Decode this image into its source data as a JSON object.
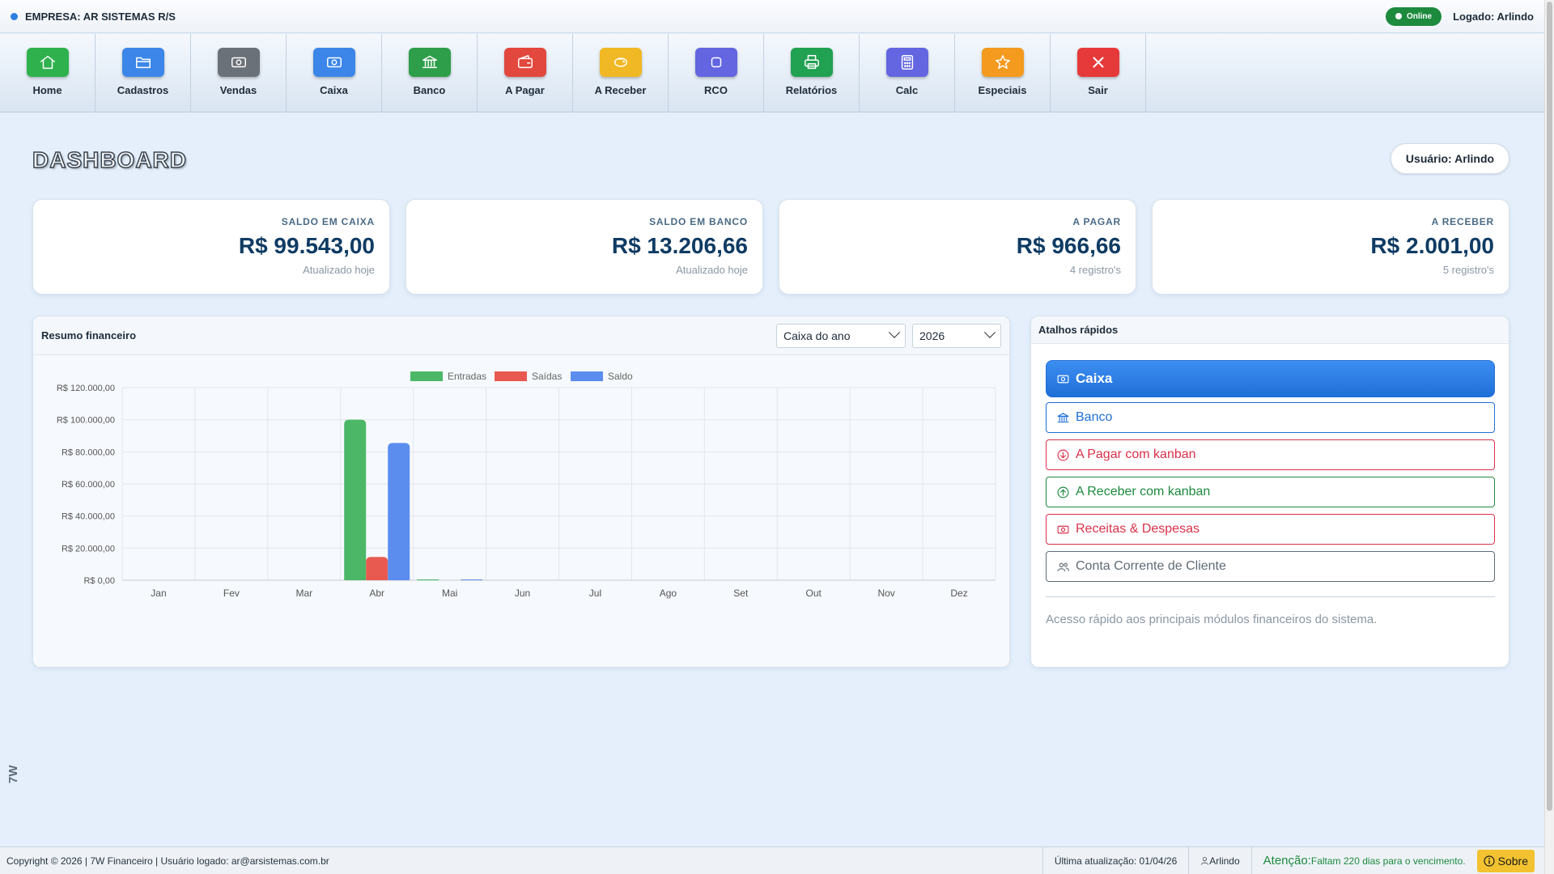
{
  "topbar": {
    "company": "EMPRESA: AR SISTEMAS R/S",
    "status": "Online",
    "logged": "Logado: Arlindo"
  },
  "toolbar": [
    {
      "label": "Home",
      "icon": "home-icon",
      "color": "#2fb14e"
    },
    {
      "label": "Cadastros",
      "icon": "folder-icon",
      "color": "#3b86e8"
    },
    {
      "label": "Vendas",
      "icon": "money-icon",
      "color": "#6b7178"
    },
    {
      "label": "Caixa",
      "icon": "cash-icon",
      "color": "#3b86e8"
    },
    {
      "label": "Banco",
      "icon": "bank-icon",
      "color": "#2e9e4a"
    },
    {
      "label": "A Pagar",
      "icon": "wallet-icon",
      "color": "#e2483d"
    },
    {
      "label": "A Receber",
      "icon": "piggy-bank-icon",
      "color": "#f0b824"
    },
    {
      "label": "RCO",
      "icon": "square-icon",
      "color": "#6366e0"
    },
    {
      "label": "Relatórios",
      "icon": "printer-icon",
      "color": "#21a152"
    },
    {
      "label": "Calc",
      "icon": "calculator-icon",
      "color": "#6366e0"
    },
    {
      "label": "Especiais",
      "icon": "star-icon",
      "color": "#f39a1f"
    },
    {
      "label": "Sair",
      "icon": "close-icon",
      "color": "#e63a3a"
    }
  ],
  "page": {
    "title": "DASHBOARD",
    "user": "Usuário: Arlindo"
  },
  "cards": [
    {
      "title": "SALDO EM CAIXA",
      "value": "R$ 99.543,00",
      "sub": "Atualizado hoje"
    },
    {
      "title": "SALDO EM BANCO",
      "value": "R$ 13.206,66",
      "sub": "Atualizado hoje"
    },
    {
      "title": "A PAGAR",
      "value": "R$ 966,66",
      "sub": "4 registro's"
    },
    {
      "title": "A RECEBER",
      "value": "R$ 2.001,00",
      "sub": "5 registro's"
    }
  ],
  "chart_panel": {
    "title": "Resumo financeiro",
    "select_type": "Caixa do ano",
    "select_year": "2026"
  },
  "chart_data": {
    "type": "bar",
    "categories": [
      "Jan",
      "Fev",
      "Mar",
      "Abr",
      "Mai",
      "Jun",
      "Jul",
      "Ago",
      "Set",
      "Out",
      "Nov",
      "Dez"
    ],
    "series": [
      {
        "name": "Entradas",
        "color": "#4cb867",
        "values": [
          0,
          0,
          0,
          100000,
          500,
          0,
          0,
          0,
          0,
          0,
          0,
          0
        ]
      },
      {
        "name": "Saídas",
        "color": "#e85a4f",
        "values": [
          0,
          0,
          0,
          14500,
          0,
          0,
          0,
          0,
          0,
          0,
          0,
          0
        ]
      },
      {
        "name": "Saldo",
        "color": "#5b8def",
        "values": [
          0,
          0,
          0,
          85500,
          500,
          0,
          0,
          0,
          0,
          0,
          0,
          0
        ]
      }
    ],
    "yticks": [
      "R$ 0,00",
      "R$ 20.000,00",
      "R$ 40.000,00",
      "R$ 60.000,00",
      "R$ 80.000,00",
      "R$ 100.000,00",
      "R$ 120.000,00"
    ],
    "ylim": [
      0,
      120000
    ],
    "legend": "top",
    "grid": true
  },
  "shortcuts": {
    "title": "Atalhos rápidos",
    "items": [
      {
        "label": "Caixa",
        "icon": "cash-icon",
        "color": "#1f6fd8"
      },
      {
        "label": "Banco",
        "icon": "bank-icon",
        "color": "#1f6fd8"
      },
      {
        "label": "A Pagar com kanban",
        "icon": "arrow-down-circle-icon",
        "color": "#d9314a"
      },
      {
        "label": "A Receber com kanban",
        "icon": "arrow-up-circle-icon",
        "color": "#1d8a3e"
      },
      {
        "label": "Receitas & Despesas",
        "icon": "cash-icon",
        "color": "#d9314a"
      },
      {
        "label": "Conta Corrente de Cliente",
        "icon": "people-icon",
        "color": "#5f6b76"
      }
    ],
    "note": "Acesso rápido aos principais módulos financeiros do sistema."
  },
  "side_brand": "7W",
  "footer": {
    "copyright": "Copyright © 2026 | 7W Financeiro | Usuário logado: ar@arsistemas.com.br",
    "last_update": "Última atualização: 01/04/26",
    "user": "Arlindo",
    "attention_title": "Atenção:",
    "attention_text": "Faltam 220 dias para o vencimento.",
    "about": "Sobre"
  }
}
